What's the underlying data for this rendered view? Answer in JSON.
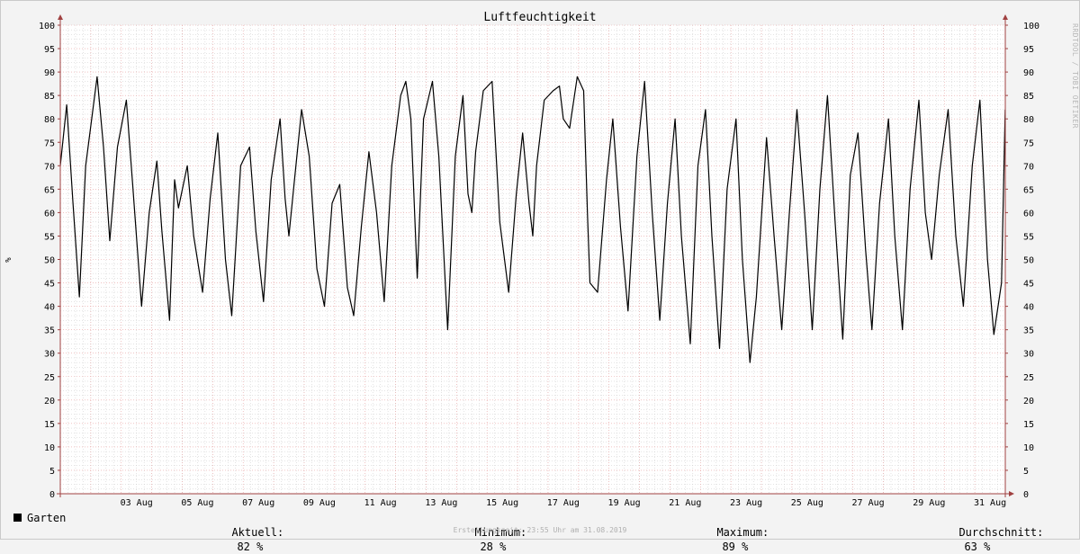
{
  "chart_data": {
    "type": "line",
    "title": "Luftfeuchtigkeit",
    "ylabel": "%",
    "ylim": [
      0,
      100
    ],
    "xlim": [
      "2019-08-01",
      "2019-08-31"
    ],
    "yticks": [
      0,
      5,
      10,
      15,
      20,
      25,
      30,
      35,
      40,
      45,
      50,
      55,
      60,
      65,
      70,
      75,
      80,
      85,
      90,
      95,
      100
    ],
    "xtick_labels": [
      {
        "date": "2019-08-03",
        "label": "03 Aug"
      },
      {
        "date": "2019-08-05",
        "label": "05 Aug"
      },
      {
        "date": "2019-08-07",
        "label": "07 Aug"
      },
      {
        "date": "2019-08-09",
        "label": "09 Aug"
      },
      {
        "date": "2019-08-11",
        "label": "11 Aug"
      },
      {
        "date": "2019-08-13",
        "label": "13 Aug"
      },
      {
        "date": "2019-08-15",
        "label": "15 Aug"
      },
      {
        "date": "2019-08-17",
        "label": "17 Aug"
      },
      {
        "date": "2019-08-19",
        "label": "19 Aug"
      },
      {
        "date": "2019-08-21",
        "label": "21 Aug"
      },
      {
        "date": "2019-08-23",
        "label": "23 Aug"
      },
      {
        "date": "2019-08-25",
        "label": "25 Aug"
      },
      {
        "date": "2019-08-27",
        "label": "27 Aug"
      },
      {
        "date": "2019-08-29",
        "label": "29 Aug"
      },
      {
        "date": "2019-08-31",
        "label": "31 Aug"
      }
    ],
    "grid": true,
    "legend_position": "bottom-left",
    "series": [
      {
        "name": "Garten",
        "color": "#000000",
        "points": [
          [
            "2019-08-01 00:00",
            70
          ],
          [
            "2019-08-01 05:00",
            83
          ],
          [
            "2019-08-01 10:00",
            62
          ],
          [
            "2019-08-01 15:00",
            42
          ],
          [
            "2019-08-01 20:00",
            70
          ],
          [
            "2019-08-02 05:00",
            89
          ],
          [
            "2019-08-02 10:00",
            74
          ],
          [
            "2019-08-02 15:00",
            54
          ],
          [
            "2019-08-02 21:00",
            74
          ],
          [
            "2019-08-03 04:00",
            84
          ],
          [
            "2019-08-03 09:00",
            66
          ],
          [
            "2019-08-03 16:00",
            40
          ],
          [
            "2019-08-03 22:00",
            60
          ],
          [
            "2019-08-04 04:00",
            71
          ],
          [
            "2019-08-04 08:00",
            56
          ],
          [
            "2019-08-04 14:00",
            37
          ],
          [
            "2019-08-04 18:00",
            67
          ],
          [
            "2019-08-04 21:00",
            61
          ],
          [
            "2019-08-05 04:00",
            70
          ],
          [
            "2019-08-05 09:00",
            55
          ],
          [
            "2019-08-05 16:00",
            43
          ],
          [
            "2019-08-05 22:00",
            63
          ],
          [
            "2019-08-06 04:00",
            77
          ],
          [
            "2019-08-06 10:00",
            50
          ],
          [
            "2019-08-06 15:00",
            38
          ],
          [
            "2019-08-06 22:00",
            70
          ],
          [
            "2019-08-07 05:00",
            74
          ],
          [
            "2019-08-07 10:00",
            56
          ],
          [
            "2019-08-07 16:00",
            41
          ],
          [
            "2019-08-07 22:00",
            67
          ],
          [
            "2019-08-08 05:00",
            80
          ],
          [
            "2019-08-08 09:00",
            63
          ],
          [
            "2019-08-08 12:00",
            55
          ],
          [
            "2019-08-08 16:00",
            66
          ],
          [
            "2019-08-08 22:00",
            82
          ],
          [
            "2019-08-09 04:00",
            72
          ],
          [
            "2019-08-09 10:00",
            48
          ],
          [
            "2019-08-09 16:00",
            40
          ],
          [
            "2019-08-09 22:00",
            62
          ],
          [
            "2019-08-10 04:00",
            66
          ],
          [
            "2019-08-10 10:00",
            44
          ],
          [
            "2019-08-10 15:00",
            38
          ],
          [
            "2019-08-10 21:00",
            57
          ],
          [
            "2019-08-11 03:00",
            73
          ],
          [
            "2019-08-11 09:00",
            60
          ],
          [
            "2019-08-11 15:00",
            41
          ],
          [
            "2019-08-11 21:00",
            70
          ],
          [
            "2019-08-12 04:00",
            85
          ],
          [
            "2019-08-12 08:00",
            88
          ],
          [
            "2019-08-12 12:00",
            80
          ],
          [
            "2019-08-12 17:00",
            46
          ],
          [
            "2019-08-12 22:00",
            80
          ],
          [
            "2019-08-13 05:00",
            88
          ],
          [
            "2019-08-13 10:00",
            72
          ],
          [
            "2019-08-13 17:00",
            35
          ],
          [
            "2019-08-13 23:00",
            72
          ],
          [
            "2019-08-14 05:00",
            85
          ],
          [
            "2019-08-14 09:00",
            64
          ],
          [
            "2019-08-14 12:00",
            60
          ],
          [
            "2019-08-14 15:00",
            73
          ],
          [
            "2019-08-14 21:00",
            86
          ],
          [
            "2019-08-15 04:00",
            88
          ],
          [
            "2019-08-15 10:00",
            58
          ],
          [
            "2019-08-15 17:00",
            43
          ],
          [
            "2019-08-15 23:00",
            64
          ],
          [
            "2019-08-16 04:00",
            77
          ],
          [
            "2019-08-16 09:00",
            62
          ],
          [
            "2019-08-16 12:00",
            55
          ],
          [
            "2019-08-16 15:00",
            70
          ],
          [
            "2019-08-16 21:00",
            84
          ],
          [
            "2019-08-17 04:00",
            86
          ],
          [
            "2019-08-17 09:00",
            87
          ],
          [
            "2019-08-17 12:00",
            80
          ],
          [
            "2019-08-17 17:00",
            78
          ],
          [
            "2019-08-17 23:00",
            89
          ],
          [
            "2019-08-18 04:00",
            86
          ],
          [
            "2019-08-18 07:00",
            60
          ],
          [
            "2019-08-18 09:00",
            45
          ],
          [
            "2019-08-18 15:00",
            43
          ],
          [
            "2019-08-18 22:00",
            67
          ],
          [
            "2019-08-19 03:00",
            80
          ],
          [
            "2019-08-19 09:00",
            57
          ],
          [
            "2019-08-19 15:00",
            39
          ],
          [
            "2019-08-19 22:00",
            72
          ],
          [
            "2019-08-20 04:00",
            88
          ],
          [
            "2019-08-20 10:00",
            60
          ],
          [
            "2019-08-20 16:00",
            37
          ],
          [
            "2019-08-20 22:00",
            62
          ],
          [
            "2019-08-21 04:00",
            80
          ],
          [
            "2019-08-21 09:00",
            55
          ],
          [
            "2019-08-21 16:00",
            32
          ],
          [
            "2019-08-21 22:00",
            70
          ],
          [
            "2019-08-22 04:00",
            82
          ],
          [
            "2019-08-22 09:00",
            55
          ],
          [
            "2019-08-22 15:00",
            31
          ],
          [
            "2019-08-22 21:00",
            65
          ],
          [
            "2019-08-23 04:00",
            80
          ],
          [
            "2019-08-23 09:00",
            50
          ],
          [
            "2019-08-23 15:00",
            28
          ],
          [
            "2019-08-23 20:00",
            42
          ],
          [
            "2019-08-24 04:00",
            76
          ],
          [
            "2019-08-24 10:00",
            55
          ],
          [
            "2019-08-24 16:00",
            35
          ],
          [
            "2019-08-24 22:00",
            60
          ],
          [
            "2019-08-25 04:00",
            82
          ],
          [
            "2019-08-25 10:00",
            60
          ],
          [
            "2019-08-25 16:00",
            35
          ],
          [
            "2019-08-25 22:00",
            65
          ],
          [
            "2019-08-26 04:00",
            85
          ],
          [
            "2019-08-26 10:00",
            58
          ],
          [
            "2019-08-26 16:00",
            33
          ],
          [
            "2019-08-26 22:00",
            68
          ],
          [
            "2019-08-27 04:00",
            77
          ],
          [
            "2019-08-27 10:00",
            52
          ],
          [
            "2019-08-27 15:00",
            35
          ],
          [
            "2019-08-27 21:00",
            62
          ],
          [
            "2019-08-28 04:00",
            80
          ],
          [
            "2019-08-28 09:00",
            55
          ],
          [
            "2019-08-28 15:00",
            35
          ],
          [
            "2019-08-28 21:00",
            65
          ],
          [
            "2019-08-29 04:00",
            84
          ],
          [
            "2019-08-29 09:00",
            60
          ],
          [
            "2019-08-29 14:00",
            50
          ],
          [
            "2019-08-29 20:00",
            68
          ],
          [
            "2019-08-30 03:00",
            82
          ],
          [
            "2019-08-30 09:00",
            55
          ],
          [
            "2019-08-30 15:00",
            40
          ],
          [
            "2019-08-30 22:00",
            70
          ],
          [
            "2019-08-31 04:00",
            84
          ],
          [
            "2019-08-31 10:00",
            50
          ],
          [
            "2019-08-31 15:00",
            34
          ],
          [
            "2019-08-31 21:00",
            45
          ],
          [
            "2019-08-31 23:55",
            82
          ]
        ]
      }
    ]
  },
  "legend": {
    "series_name": "Garten",
    "current_label": "Aktuell:",
    "current_value": "82 %",
    "min_label": "Minimum:",
    "min_value": "28 %",
    "max_label": "Maximum:",
    "max_value": "89 %",
    "avg_label": "Durchschnitt:",
    "avg_value": "63 %"
  },
  "footer": "Erstellungszeit: 23:55 Uhr am 31.08.2019",
  "watermark": "RRDTOOL / TOBI OETIKER",
  "colors": {
    "background": "#f3f3f3",
    "plot_background": "#ffffff",
    "major_grid": "#e8a0a0",
    "minor_grid": "#c8c8c8",
    "axis": "#a04040",
    "line": "#000000"
  }
}
